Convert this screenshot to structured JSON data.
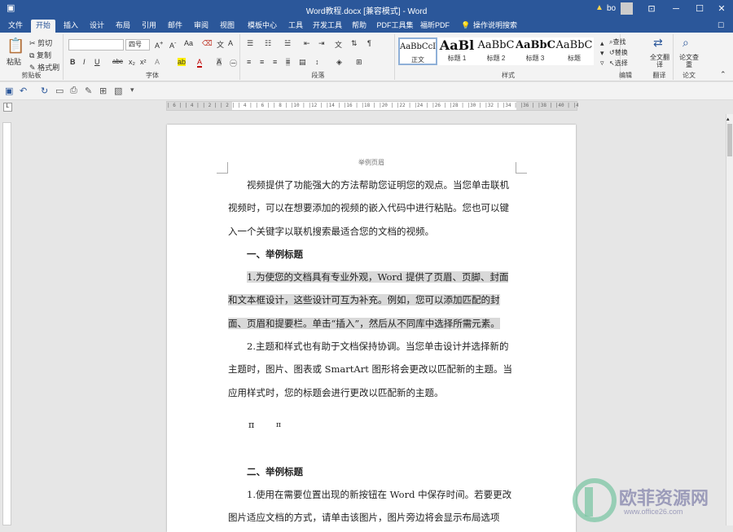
{
  "titlebar": {
    "title": "Word教程.docx [兼容模式] - Word",
    "user": "bo",
    "warning": "▲"
  },
  "tabs": [
    "文件",
    "开始",
    "插入",
    "设计",
    "布局",
    "引用",
    "邮件",
    "审阅",
    "视图",
    "模板中心",
    "工具",
    "开发工具",
    "帮助",
    "PDF工具集",
    "福昕PDF",
    "操作说明搜索"
  ],
  "ribbon": {
    "clipboard": {
      "paste": "粘贴",
      "cut": "剪切",
      "copy": "复制",
      "format": "格式刷",
      "label": "剪贴板"
    },
    "font": {
      "size": "四号",
      "label": "字体"
    },
    "paragraph": {
      "label": "段落"
    },
    "styles": {
      "label": "样式",
      "items": [
        {
          "preview": "AaBbCcI",
          "name": "正文"
        },
        {
          "preview": "AaBl",
          "name": "标题 1"
        },
        {
          "preview": "AaBbC",
          "name": "标题 2"
        },
        {
          "preview": "AaBbC",
          "name": "标题 3"
        },
        {
          "preview": "AaBbC",
          "name": "标题"
        }
      ]
    },
    "editing": {
      "find": "查找",
      "replace": "替换",
      "select": "选择",
      "label": "编辑"
    },
    "translate": {
      "btn": "全文翻译",
      "label": "翻译"
    },
    "paper": {
      "btn": "论文查重",
      "label": "论文"
    }
  },
  "ruler": {
    "h": "| 6 | | 4 | | 2 |     | 2 | | 4 | | 6 | | 8 | |10 | |12 | |14 | |16 | |18 | |20 | |22 | |24 | |26 | |28 | |30 | |32 | |34 | |36 | |38 | |40 | |42"
  },
  "doc": {
    "header": "举例页眉",
    "p1": "视频提供了功能强大的方法帮助您证明您的观点。当您单击联机视频时，可以在想要添加的视频的嵌入代码中进行粘贴。您也可以键入一个关键字以联机搜索最适合您的文档的视频。",
    "h1": "一、举例标题",
    "p2": "1.为使您的文档具有专业外观，Word 提供了页眉、页脚、封面和文本框设计，这些设计可互为补充。例如，您可以添加匹配的封面、页眉和提要栏。单击“插入”，然后从不同库中选择所需元素。",
    "p3": "2.主题和样式也有助于文档保持协调。当您单击设计并选择新的主题时，图片、图表或 SmartArt 图形将会更改以匹配新的主题。当应用样式时，您的标题会进行更改以匹配新的主题。",
    "pi1": "π",
    "pi2": "π",
    "h2": "二、举例标题",
    "p4": "1.使用在需要位置出现的新按钮在 Word 中保存时间。若要更改图片适应文档的方式，请单击该图片，图片旁边将会显示布局选项"
  },
  "watermark": {
    "text": "欧菲资源网",
    "url": "www.office26.com"
  }
}
